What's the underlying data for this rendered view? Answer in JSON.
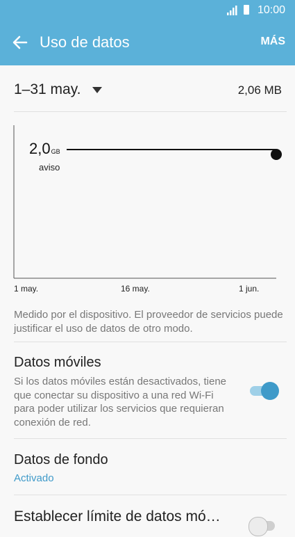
{
  "status": {
    "time": "10:00"
  },
  "appbar": {
    "title": "Uso de datos",
    "more_label": "MÁS"
  },
  "cycle": {
    "range": "1–31 may.",
    "total": "2,06 MB"
  },
  "chart": {
    "warning_value": "2,0",
    "warning_unit": "GB",
    "warning_label": "aviso",
    "ticks": [
      "1 may.",
      "16 may.",
      "1 jun."
    ]
  },
  "note": "Medido por el dispositivo. El proveedor de servicios puede justificar el uso de datos de otro modo.",
  "mobile_data": {
    "title": "Datos móviles",
    "description": "Si los datos móviles están desactivados, tiene que conectar su dispositivo a una red Wi-Fi para poder utilizar los servicios que requieran conexión de red.",
    "enabled": true
  },
  "background_data": {
    "title": "Datos de fondo",
    "status": "Activado"
  },
  "limit": {
    "title": "Establecer límite de datos mó…",
    "enabled": false
  },
  "colors": {
    "accent": "#5bb1d9",
    "toggle_on": "#3f9ac9",
    "link": "#3f9ac9"
  }
}
